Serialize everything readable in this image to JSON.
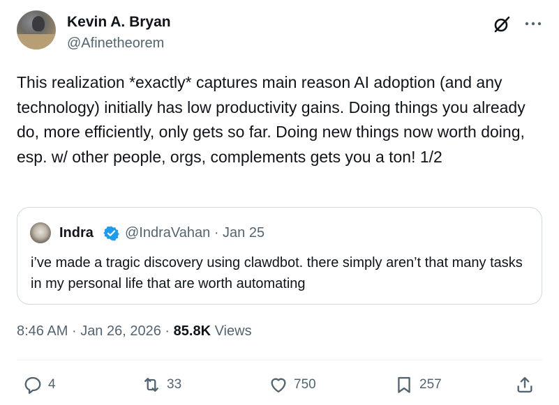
{
  "author": {
    "name": "Kevin A. Bryan",
    "handle": "@Afinetheorem"
  },
  "tweet": {
    "text": "This realization *exactly* captures main reason AI adoption (and any technology) initially has low productivity gains. Doing things you already do, more efficiently, only gets so far. Doing new things now worth doing, esp. w/ other people, orgs, complements gets you a ton! 1/2"
  },
  "quote": {
    "name": "Indra",
    "handle": "@IndraVahan",
    "separator": "·",
    "date": "Jan 25",
    "text": "i’ve made a tragic discovery using clawdbot. there simply aren’t that many tasks in my personal life that are worth automating"
  },
  "meta": {
    "time": "8:46 AM",
    "separator": "·",
    "date": "Jan 26, 2026",
    "views_count": "85.8K",
    "views_label": "Views"
  },
  "actions": {
    "replies": "4",
    "reposts": "33",
    "likes": "750",
    "bookmarks": "257"
  },
  "icons": {
    "header": [
      "grok-icon",
      "more-icon"
    ],
    "actions": [
      "reply-icon",
      "retweet-icon",
      "like-icon",
      "bookmark-icon",
      "share-icon"
    ],
    "verified": "verified-badge-icon"
  },
  "colors": {
    "text": "#0f1419",
    "secondary": "#536471",
    "verified": "#1d9bf0",
    "border": "#cfd9de"
  }
}
